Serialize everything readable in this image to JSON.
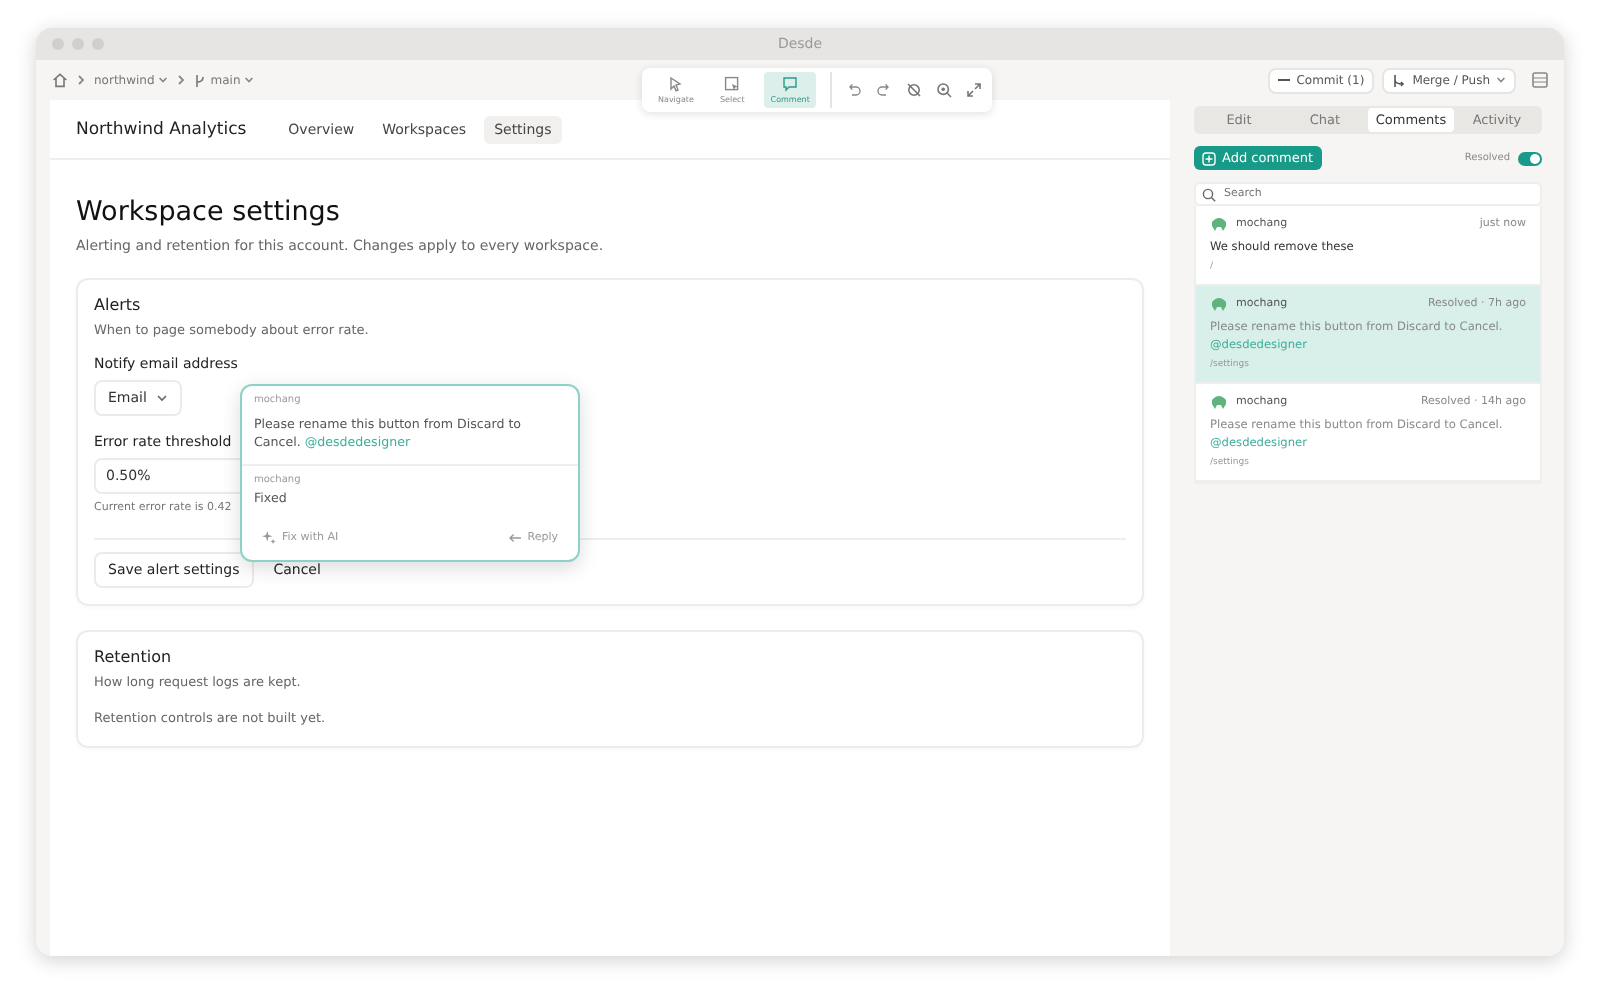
{
  "window": {
    "title": "Desde"
  },
  "breadcrumb": [
    {
      "label": "northwind",
      "kind": "project"
    },
    {
      "label": "main",
      "kind": "branch"
    }
  ],
  "canvas_tools": [
    {
      "label": "Navigate",
      "kind": "navigate",
      "selected": false
    },
    {
      "label": "Select",
      "kind": "select",
      "selected": false
    },
    {
      "label": "Comment",
      "kind": "comment",
      "selected": true
    }
  ],
  "actions": [
    {
      "label": "Commit (1)",
      "kind": "commit"
    },
    {
      "label": "Merge / Push",
      "kind": "merge"
    }
  ],
  "app": {
    "brand": "Northwind Analytics",
    "nav": [
      {
        "label": "Overview",
        "selected": false
      },
      {
        "label": "Workspaces",
        "selected": false
      },
      {
        "label": "Settings",
        "selected": true
      }
    ]
  },
  "page": {
    "title": "Workspace settings",
    "subtitle": "Alerting and retention for this account. Changes apply to every workspace."
  },
  "alerts": {
    "title": "Alerts",
    "description": "When to page somebody about error rate.",
    "email_label": "Notify email address",
    "email_value": "Email",
    "threshold_label": "Error rate threshold",
    "threshold_value": "0.50%",
    "hint": "Current error rate is 0.42",
    "buttons": [
      {
        "label": "Save alert settings",
        "kind": "outline"
      },
      {
        "label": "Cancel",
        "kind": "plain"
      }
    ]
  },
  "retention": {
    "title": "Retention",
    "description": "How long request logs are kept.",
    "note": "Retention controls are not built yet."
  },
  "popover": {
    "messages": [
      {
        "author": "mochang",
        "text": "Please rename this button from Discard to Cancel.",
        "mention": "@desdedesigner"
      },
      {
        "author": "mochang",
        "text": "Fixed"
      }
    ],
    "fix_label": "Fix with AI",
    "reply_label": "Reply"
  },
  "panel": {
    "tabs": [
      {
        "label": "Edit",
        "selected": false
      },
      {
        "label": "Chat",
        "selected": false
      },
      {
        "label": "Comments",
        "selected": true
      },
      {
        "label": "Activity",
        "selected": false
      }
    ],
    "add_comment": "Add comment",
    "resolved_toggle": {
      "label": "Resolved",
      "on": true
    },
    "search": {
      "placeholder": "Search"
    },
    "comments": [
      {
        "author": "mochang",
        "meta": "just now",
        "text": "We should remove these",
        "path": "/",
        "resolved": false,
        "selected": false
      },
      {
        "author": "mochang",
        "meta": "Resolved · 7h ago",
        "text": "Please rename this button from Discard to Cancel.",
        "mention": "@desdedesigner",
        "path": "/settings",
        "resolved": true,
        "selected": true
      },
      {
        "author": "mochang",
        "meta": "Resolved · 14h ago",
        "text": "Please rename this button from Discard to Cancel.",
        "mention": "@desdedesigner",
        "path": "/settings",
        "resolved": true,
        "selected": false
      }
    ]
  }
}
